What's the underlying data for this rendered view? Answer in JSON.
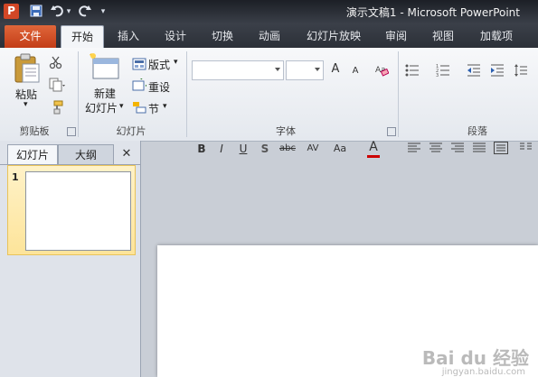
{
  "titlebar": {
    "app_icon": "P",
    "title": "演示文稿1  -  Microsoft PowerPoint",
    "qat_icons": [
      "save-icon",
      "undo-icon",
      "redo-icon",
      "customize-icon"
    ]
  },
  "tabs": {
    "file": "文件",
    "items": [
      "开始",
      "插入",
      "设计",
      "切换",
      "动画",
      "幻灯片放映",
      "审阅",
      "视图",
      "加载项"
    ],
    "active": "开始"
  },
  "ribbon": {
    "clipboard": {
      "paste": "粘贴",
      "group": "剪贴板"
    },
    "slides": {
      "new_slide_1": "新建",
      "new_slide_2": "幻灯片",
      "layout": "版式",
      "reset": "重设",
      "section": "节",
      "group": "幻灯片"
    },
    "font": {
      "group": "字体",
      "grow": "A",
      "shrink": "A",
      "buttons": [
        "B",
        "I",
        "U",
        "S",
        "abc",
        "AV",
        "Aa",
        "A"
      ]
    },
    "paragraph": {
      "group": "段落"
    }
  },
  "panel": {
    "tab_slides": "幻灯片",
    "tab_outline": "大纲",
    "close": "✕",
    "slide_number": "1"
  },
  "watermark": {
    "brand": "Bai du 经验",
    "url": "jingyan.baidu.com"
  },
  "colors": {
    "accent": "#d24726",
    "file_tab": "#c33d17",
    "selection": "#fde49a"
  }
}
